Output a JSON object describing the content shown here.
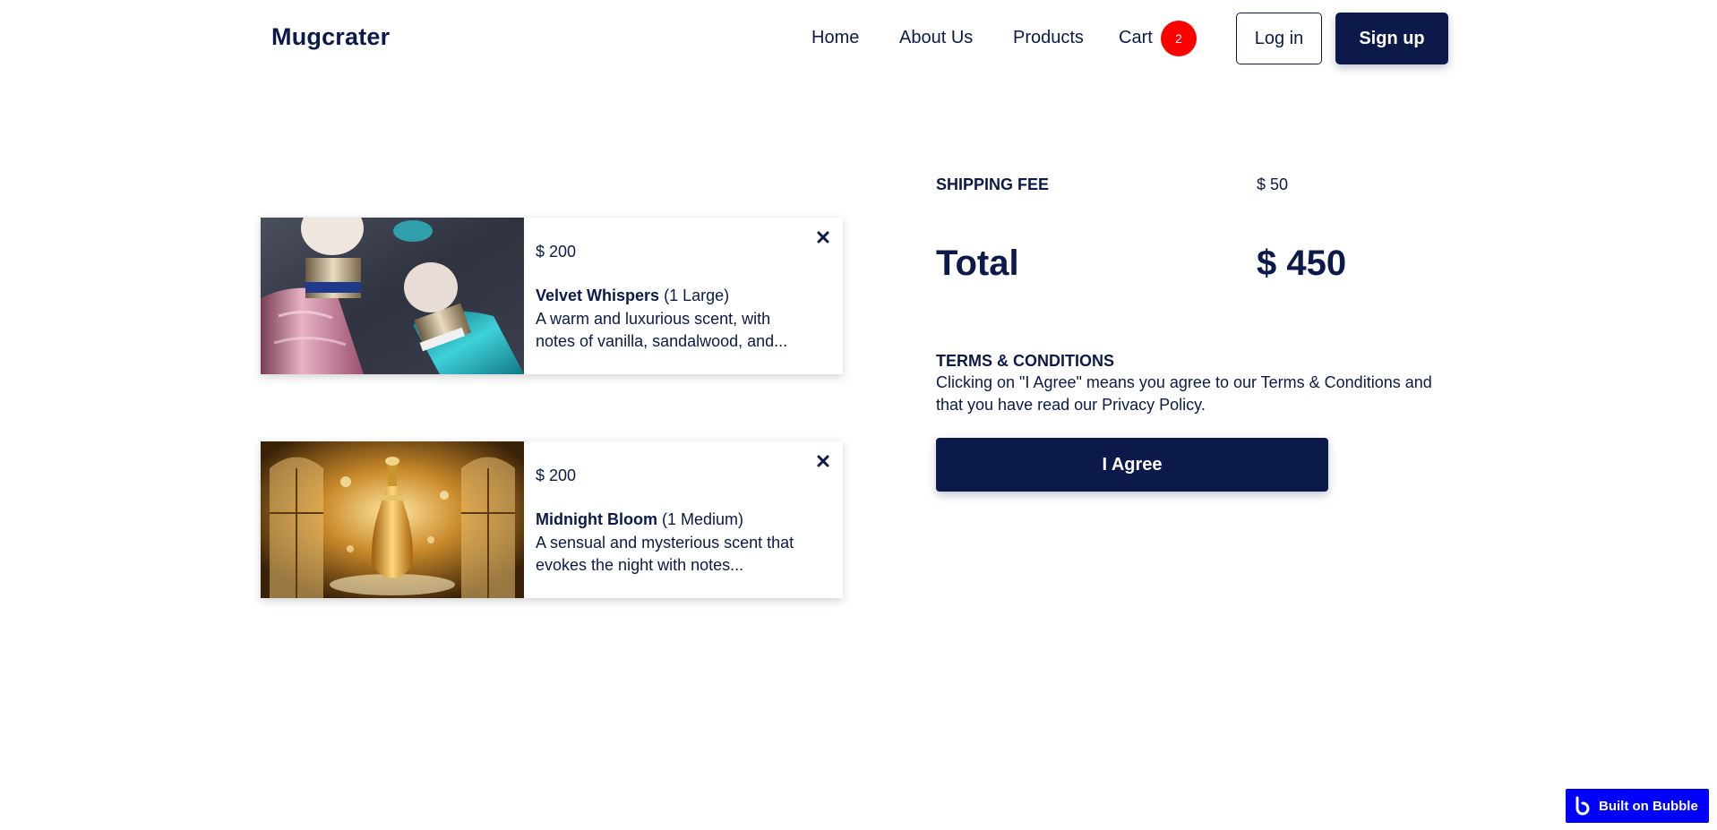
{
  "header": {
    "brand": "Mugcrater",
    "nav": {
      "home": "Home",
      "about": "About Us",
      "products": "Products",
      "cart": "Cart"
    },
    "cart_count": "2",
    "login_label": "Log in",
    "signup_label": "Sign up"
  },
  "cart": {
    "items": [
      {
        "price": "$ 200",
        "name": "Velvet Whispers",
        "variant": "(1 Large)",
        "description": "A warm and luxurious scent, with notes of vanilla, sandalwood, and..."
      },
      {
        "price": "$ 200",
        "name": "Midnight Bloom",
        "variant": "(1 Medium)",
        "description": "A sensual and mysterious scent that evokes the night with notes..."
      }
    ]
  },
  "summary": {
    "shipping_label": "SHIPPING FEE",
    "shipping_value": "$ 50",
    "total_label": "Total",
    "total_value": "$ 450",
    "terms_title": "TERMS & CONDITIONS",
    "terms_text": "Clicking on \"I Agree\" means you agree to our Terms & Conditions and that you have read our Privacy Policy.",
    "agree_label": "I Agree"
  },
  "badge": {
    "label": "Built on Bubble"
  },
  "colors": {
    "navy": "#0c1a4b",
    "badge_red": "#ff0000",
    "bubble_blue": "#0000ff"
  }
}
